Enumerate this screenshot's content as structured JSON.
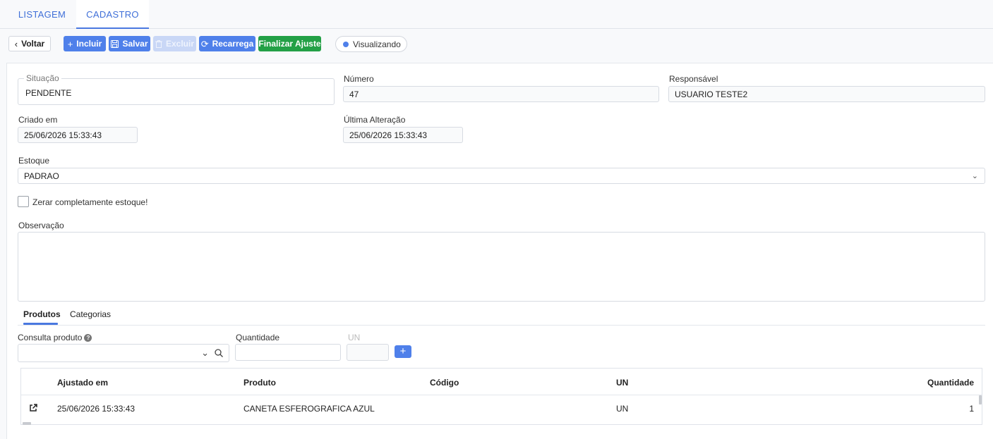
{
  "tabs": {
    "listagem": "LISTAGEM",
    "cadastro": "CADASTRO"
  },
  "toolbar": {
    "voltar": "Voltar",
    "incluir": "Incluir",
    "salvar": "Salvar",
    "excluir": "Excluir",
    "recarrega": "Recarrega",
    "finalizar": "Finalizar Ajuste",
    "status": "Visualizando"
  },
  "form": {
    "situacao_label": "Situação",
    "situacao_value": "PENDENTE",
    "numero_label": "Número",
    "numero_value": "47",
    "responsavel_label": "Responsável",
    "responsavel_value": "USUARIO TESTE2",
    "criado_label": "Criado em",
    "criado_value": "25/06/2026 15:33:43",
    "alteracao_label": "Última Alteração",
    "alteracao_value": "25/06/2026 15:33:43",
    "estoque_label": "Estoque",
    "estoque_value": "PADRAO",
    "zerar_label": "Zerar completamente estoque!",
    "zerar_checked": false,
    "observacao_label": "Observação",
    "observacao_value": ""
  },
  "inner_tabs": {
    "produtos": "Produtos",
    "categorias": "Categorias"
  },
  "product_entry": {
    "consulta_label": "Consulta produto",
    "consulta_value": "",
    "quantidade_label": "Quantidade",
    "quantidade_value": "",
    "un_label": "UN",
    "un_value": ""
  },
  "table": {
    "columns": [
      "Ajustado em",
      "Produto",
      "Código",
      "UN",
      "Quantidade"
    ],
    "rows": [
      {
        "ajustado_em": "25/06/2026 15:33:43",
        "produto": "CANETA ESFEROGRAFICA AZUL",
        "codigo": "",
        "un": "UN",
        "quantidade": "1"
      }
    ]
  },
  "colors": {
    "primary": "#4f80ea",
    "success": "#23a046",
    "disabled": "#c9d7f6",
    "tab_accent": "#4a78e0"
  }
}
